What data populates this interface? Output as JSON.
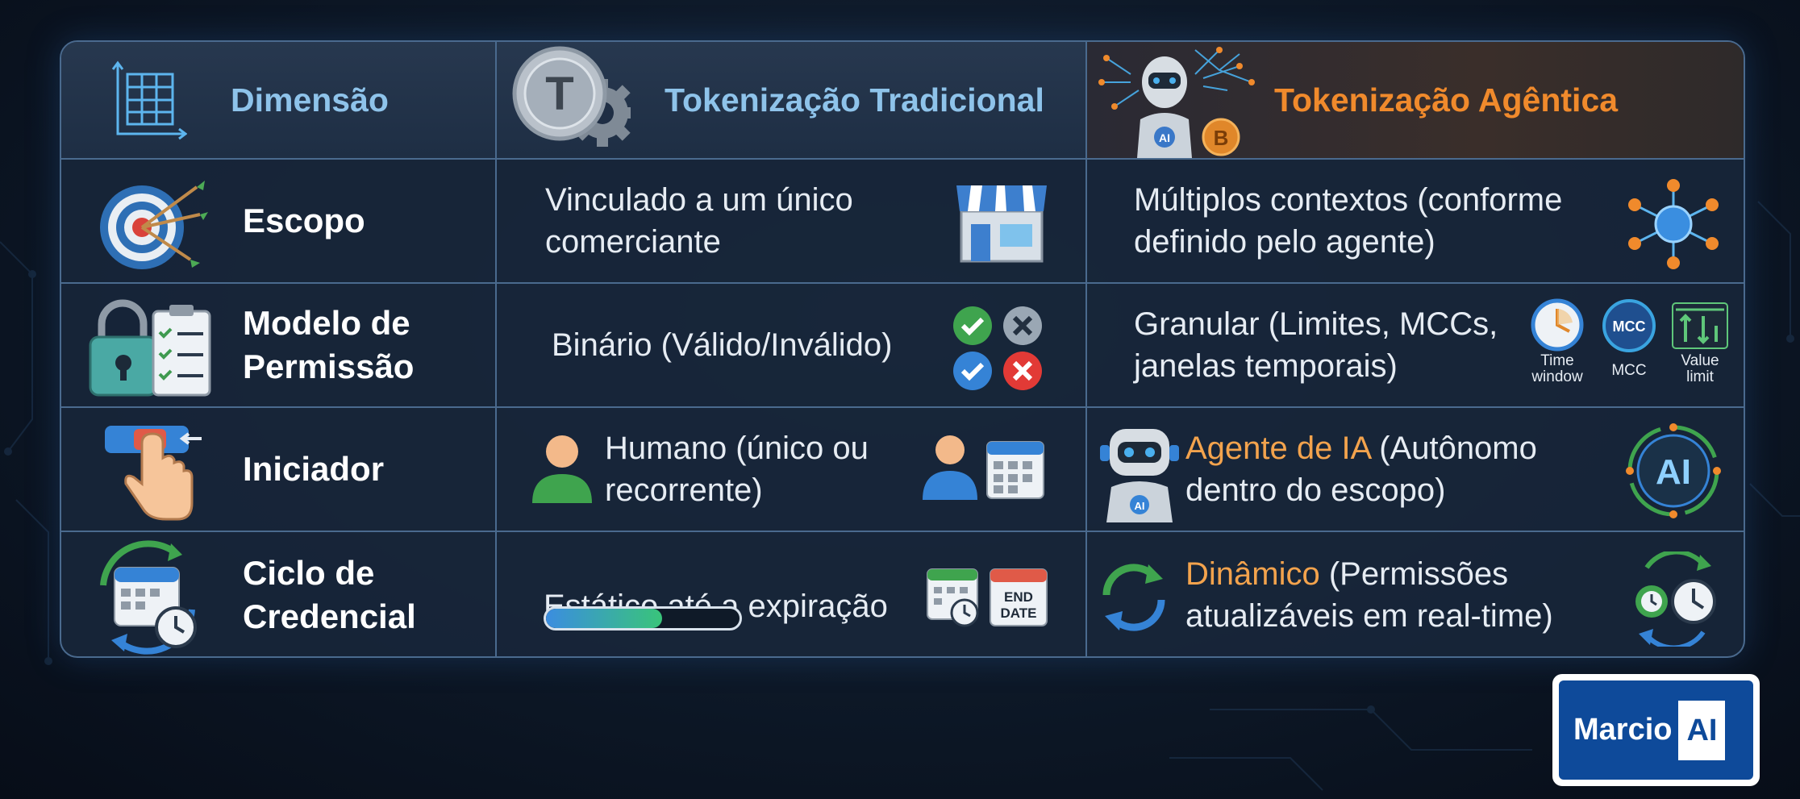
{
  "header": {
    "dimension": "Dimensão",
    "traditional": "Tokenização Tradicional",
    "agentic": "Tokenização Agêntica"
  },
  "rows": [
    {
      "label": "Escopo",
      "traditional": [
        "Vinculado a um único",
        "comerciante"
      ],
      "agentic": [
        "Múltiplos contextos (conforme",
        "definido pelo agente)"
      ]
    },
    {
      "label": [
        "Modelo de",
        "Permissão"
      ],
      "traditional": "Binário (Válido/Inválido)",
      "agentic": [
        "Granular (Limites, MCCs,",
        "janelas temporais)"
      ],
      "agentic_icons": {
        "mcc_badge": "MCC",
        "time_window": [
          "Time",
          "window"
        ],
        "mcc": "MCC",
        "value_limit": [
          "Value",
          "limit"
        ]
      }
    },
    {
      "label": "Iniciador",
      "traditional": [
        "Humano (único ou",
        "recorrente)"
      ],
      "agentic_highlight": "Agente de IA",
      "agentic_rest": " (Autônomo",
      "agentic_line2": "dentro do escopo)",
      "ai_badge": "AI",
      "robot_badge": "AI"
    },
    {
      "label": [
        "Ciclo de",
        "Credencial"
      ],
      "traditional": "Estático até a expiração",
      "progress": 0.6,
      "end_date": [
        "END",
        "DATE"
      ],
      "agentic_highlight": "Dinâmico",
      "agentic_rest": " (Permissões",
      "agentic_line2": "atualizáveis em real-time)"
    }
  ],
  "logo": {
    "name": "Marcio",
    "suffix": "AI"
  },
  "coin_letter": "T",
  "coin_b": "B",
  "robot_chest": "AI",
  "colors": {
    "accent_blue": "#8ec3ea",
    "accent_orange": "#f08a2c",
    "border": "#4a6a8e"
  }
}
